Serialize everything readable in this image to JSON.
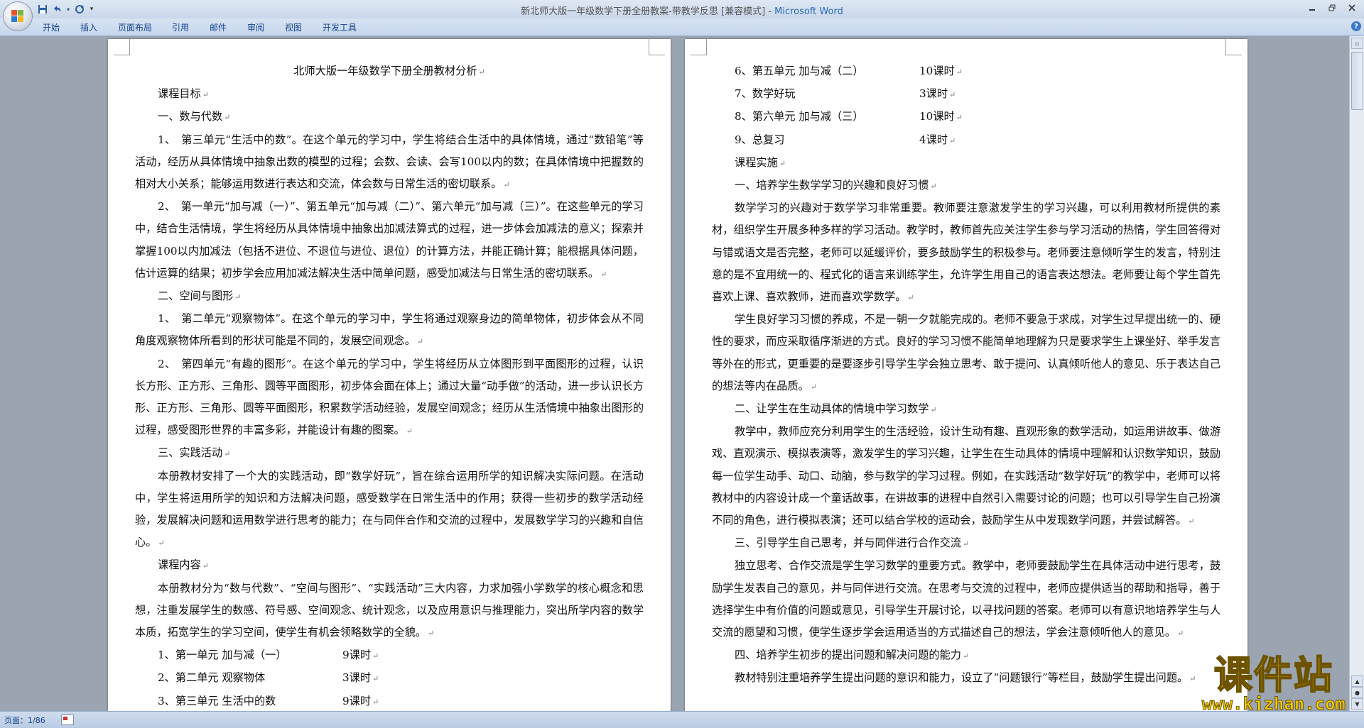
{
  "window": {
    "title": "新北师大版一年级数学下册全册教案-带教学反思 [兼容模式]",
    "title_sep": " - ",
    "app_name": "Microsoft Word"
  },
  "qat": {
    "save_icon": "save-icon",
    "undo_icon": "undo-icon",
    "redo_icon": "redo-icon",
    "customize_icon": "customize-icon"
  },
  "ribbon": {
    "tabs": [
      "开始",
      "插入",
      "页面布局",
      "引用",
      "邮件",
      "审阅",
      "视图",
      "开发工具"
    ]
  },
  "page1": {
    "title": "北师大版一年级数学下册全册教材分析",
    "paras": [
      "课程目标",
      "一、数与代数",
      "1、　第三单元“生活中的数”。在这个单元的学习中，学生将结合生活中的具体情境，通过“数铅笔”等活动，经历从具体情境中抽象出数的模型的过程；会数、会读、会写100以内的数；在具体情境中把握数的相对大小关系；能够运用数进行表达和交流，体会数与日常生活的密切联系。",
      "2、　第一单元“加与减（一）”、第五单元“加与减（二）”、第六单元“加与减（三）”。在这些单元的学习中，结合生活情境，学生将经历从具体情境中抽象出加减法算式的过程，进一步体会加减法的意义；探索并掌握100以内加减法（包括不进位、不退位与进位、退位）的计算方法，并能正确计算；能根据具体问题，估计运算的结果；初步学会应用加减法解决生活中简单问题，感受加减法与日常生活的密切联系。",
      "二、空间与图形",
      "1、　第二单元“观察物体”。在这个单元的学习中，学生将通过观察身边的简单物体，初步体会从不同角度观察物体所看到的形状可能是不同的，发展空间观念。",
      "2、　第四单元“有趣的图形”。在这个单元的学习中，学生将经历从立体图形到平面图形的过程，认识长方形、正方形、三角形、圆等平面图形，初步体会面在体上；通过大量“动手做”的活动，进一步认识长方形、正方形、三角形、圆等平面图形，积累数学活动经验，发展空间观念；经历从生活情境中抽象出图形的过程，感受图形世界的丰富多彩，并能设计有趣的图案。",
      "三、实践活动",
      "本册教材安排了一个大的实践活动，即“数学好玩”，旨在综合运用所学的知识解决实际问题。在活动中，学生将运用所学的知识和方法解决问题，感受数学在日常生活中的作用；获得一些初步的数学活动经验，发展解决问题和运用数学进行思考的能力；在与同伴合作和交流的过程中，发展数学学习的兴趣和自信心。",
      "课程内容",
      "本册教材分为“数与代数”、“空间与图形”、“实践活动”三大内容，力求加强小学数学的核心概念和思想，注重发展学生的数感、符号感、空间观念、统计观念，以及应用意识与推理能力，突出所学内容的数学本质，拓宽学生的学习空间，使学生有机会领略数学的全貌。"
    ],
    "units": [
      {
        "name": "1、第一单元  加与减（一）",
        "hours": "9课时"
      },
      {
        "name": "2、第二单元  观察物体",
        "hours": "3课时"
      },
      {
        "name": "3、第三单元  生活中的数",
        "hours": "9课时"
      }
    ]
  },
  "page2": {
    "units": [
      {
        "name": "6、第五单元  加与减（二）",
        "hours": "10课时"
      },
      {
        "name": "7、数学好玩",
        "hours": "3课时"
      },
      {
        "name": "8、第六单元  加与减（三）",
        "hours": "10课时"
      },
      {
        "name": "9、总复习",
        "hours": "4课时"
      }
    ],
    "paras": [
      "课程实施",
      "一、培养学生数学学习的兴趣和良好习惯",
      "数学学习的兴趣对于数学学习非常重要。教师要注意激发学生的学习兴趣，可以利用教材所提供的素材，组织学生开展多种多样的学习活动。教学时，教师首先应关注学生参与学习活动的热情，学生回答得对与错或语文是否完整，老师可以延缓评价，要多鼓励学生的积极参与。老师要注意倾听学生的发言，特别注意的是不宜用统一的、程式化的语言来训练学生，允许学生用自己的语言表达想法。老师要让每个学生首先喜欢上课、喜欢教师，进而喜欢学数学。",
      "学生良好学习习惯的养成，不是一朝一夕就能完成的。老师不要急于求成，对学生过早提出统一的、硬性的要求，而应采取循序渐进的方式。良好的学习习惯不能简单地理解为只是要求学生上课坐好、举手发言等外在的形式，更重要的是要逐步引导学生学会独立思考、敢于提问、认真倾听他人的意见、乐于表达自己的想法等内在品质。",
      "二、让学生在生动具体的情境中学习数学",
      "教学中，教师应充分利用学生的生活经验，设计生动有趣、直观形象的数学活动，如运用讲故事、做游戏、直观演示、模拟表演等，激发学生的学习兴趣，让学生在生动具体的情境中理解和认识数学知识，鼓励每一位学生动手、动口、动脑，参与数学的学习过程。例如，在实践活动“数学好玩”的教学中，老师可以将教材中的内容设计成一个童话故事，在讲故事的进程中自然引入需要讨论的问题；也可以引导学生自己扮演不同的角色，进行模拟表演；还可以结合学校的运动会，鼓励学生从中发现数学问题，并尝试解答。",
      "三、引导学生自己思考，并与同伴进行合作交流",
      "独立思考、合作交流是学生学习数学的重要方式。教学中，老师要鼓励学生在具体活动中进行思考，鼓励学生发表自己的意见，并与同伴进行交流。在思考与交流的过程中，老师应提供适当的帮助和指导，善于选择学生中有价值的问题或意见，引导学生开展讨论，以寻找问题的答案。老师可以有意识地培养学生与人交流的愿望和习惯，使学生逐步学会运用适当的方式描述自己的想法，学会注意倾听他人的意见。",
      "四、培养学生初步的提出问题和解决问题的能力",
      "教材特别注重培养学生提出问题的意识和能力，设立了“问题银行”等栏目，鼓励学生提出问题。"
    ]
  },
  "statusbar": {
    "page_label": "页面：1/86"
  },
  "watermark": {
    "text": "课件站",
    "url": "www.kjzhan.com"
  },
  "colors": {
    "app_name": "#2a6ab8",
    "tab_text": "#15428b",
    "watermark_fill": "#f4d000"
  }
}
